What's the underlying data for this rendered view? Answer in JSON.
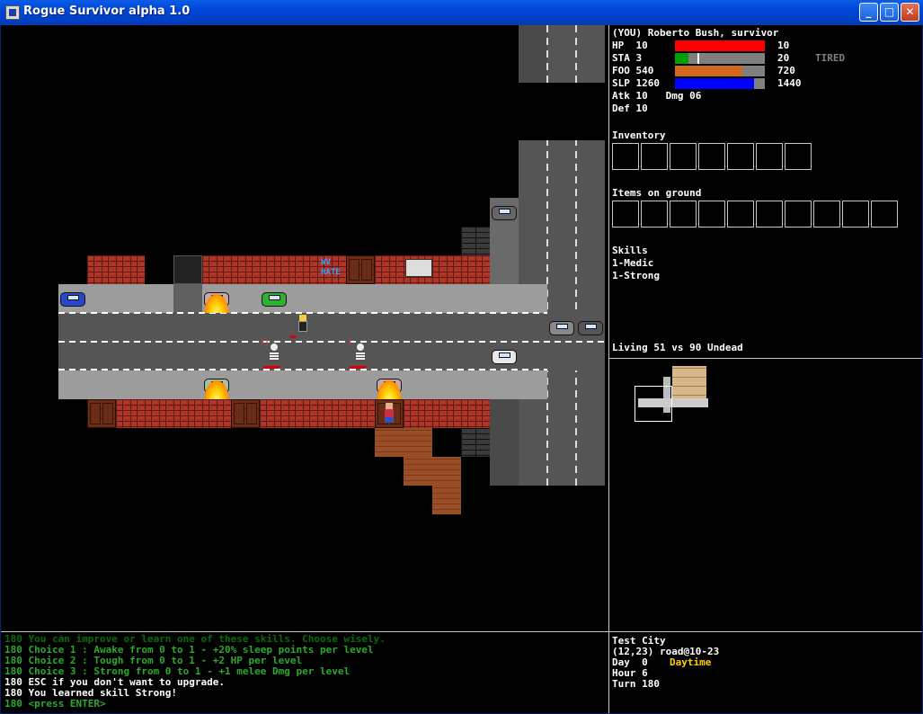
{
  "window": {
    "title": "Rogue Survivor alpha 1.0",
    "buttons": {
      "minimize": "_",
      "maximize": "□",
      "close": "✕"
    }
  },
  "status": {
    "player_line": "(YOU) Roberto Bush, survivor",
    "hp": {
      "label": "HP  10",
      "max": "10",
      "value": 10,
      "maximum": 10,
      "color": "#ff0000"
    },
    "sta": {
      "label": "STA 3",
      "max": "20",
      "state": "TIRED",
      "value": 3,
      "maximum": 20,
      "color": "#00a000"
    },
    "foo": {
      "label": "FOO 540",
      "max": "720",
      "value": 540,
      "maximum": 720,
      "color": "#d2691e"
    },
    "slp": {
      "label": "SLP 1260",
      "max": "1440",
      "value": 1260,
      "maximum": 1440,
      "color": "#0000ff"
    },
    "atk_line": "Atk 10   Dmg 06",
    "def_line": "Def 10"
  },
  "inventory": {
    "title": "Inventory",
    "slot_count": 7
  },
  "ground": {
    "title": "Items on ground",
    "slot_count": 10
  },
  "skills": {
    "title": "Skills",
    "items": [
      "1-Medic",
      "1-Strong"
    ]
  },
  "population": "Living 51 vs 90 Undead",
  "log": [
    {
      "text": "180 You can improve or learn one of these skills. Choose wisely.",
      "color": "#0a6a0a"
    },
    {
      "text": "180 Choice 1 : Awake from 0 to 1 - +20% sleep points per level",
      "color": "#2ea82e"
    },
    {
      "text": "180 Choice 2 : Tough from 0 to 1 - +2 HP per level",
      "color": "#2ea82e"
    },
    {
      "text": "180 Choice 3 : Strong from 0 to 1 - +1 melee Dmg per level",
      "color": "#2ea82e"
    },
    {
      "text": "180 ESC if you don't want to upgrade.",
      "color": "#ffffff"
    },
    {
      "text": "180 You learned skill Strong!",
      "color": "#ffffff"
    },
    {
      "text": "180 <press ENTER>",
      "color": "#2ea82e"
    }
  ],
  "location": {
    "city": "Test City",
    "position": "(12,23) road@10-23",
    "day": "Day  0",
    "daytime": "Daytime",
    "hour": "Hour 6",
    "turn": "Turn 180"
  },
  "map": {
    "graffiti": [
      "WV",
      "HATE"
    ],
    "markers": [
      "!!",
      "!"
    ]
  }
}
